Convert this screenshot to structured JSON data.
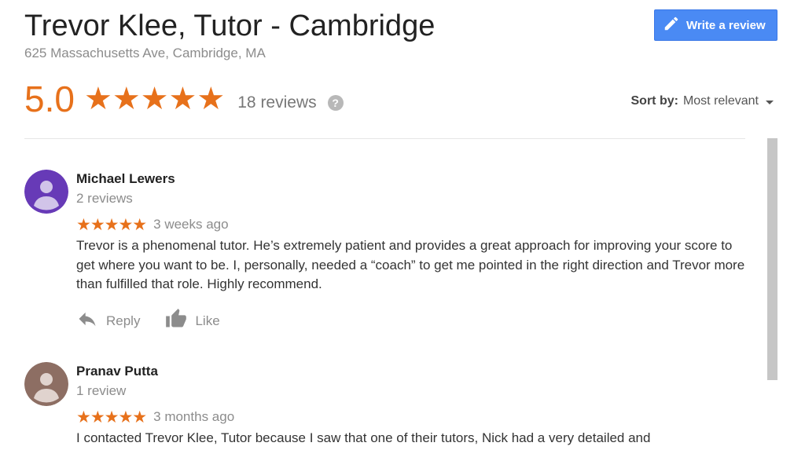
{
  "header": {
    "title": "Trevor Klee, Tutor - Cambridge",
    "address": "625 Massachusetts Ave, Cambridge, MA",
    "write_review_label": "Write a review",
    "write_icon": "pencil-icon"
  },
  "summary": {
    "rating": "5.0",
    "stars": "★★★★★",
    "reviews_count": "18 reviews",
    "help_icon_glyph": "?"
  },
  "sort": {
    "label": "Sort by:",
    "value": "Most relevant"
  },
  "reviews": [
    {
      "name": "Michael Lewers",
      "count": "2 reviews",
      "stars": "★★★★★",
      "when": "3 weeks ago",
      "text": "Trevor is a phenomenal tutor. He’s extremely patient and provides a great approach for improving your score to get where you want to be. I, personally, needed a “coach” to get me pointed in the right direction and Trevor more than fulfilled that role. Highly recommend.",
      "reply_label": "Reply",
      "like_label": "Like",
      "avatar_color": "#673ab7"
    },
    {
      "name": "Pranav Putta",
      "count": "1 review",
      "stars": "★★★★★",
      "when": "3 months ago",
      "text": "I contacted Trevor Klee, Tutor because I saw that one of their tutors, Nick had a very detailed and",
      "avatar_color": "#8d6e63"
    }
  ],
  "colors": {
    "accent": "#e7711b",
    "button": "#4a8af4",
    "muted": "#8c8c8c"
  }
}
